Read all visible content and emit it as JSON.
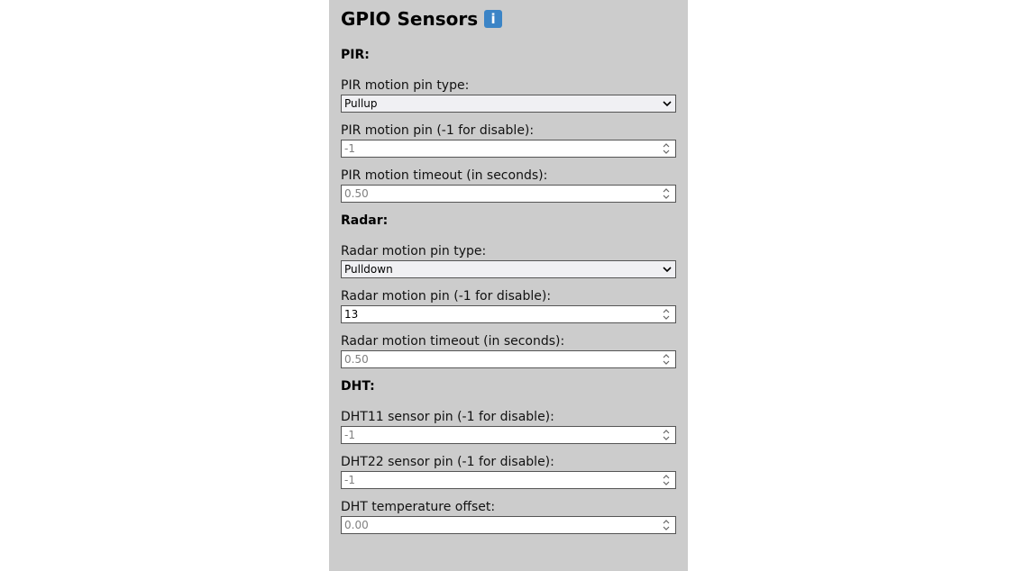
{
  "header": {
    "title": "GPIO Sensors",
    "info_icon": "info-icon",
    "info_glyph": "i"
  },
  "pir": {
    "heading": "PIR:",
    "pin_type_label": "PIR motion pin type:",
    "pin_type_value": "Pullup",
    "pin_label": "PIR motion pin (-1 for disable):",
    "pin_value": "-1",
    "timeout_label": "PIR motion timeout (in seconds):",
    "timeout_value": "0.50"
  },
  "radar": {
    "heading": "Radar:",
    "pin_type_label": "Radar motion pin type:",
    "pin_type_value": "Pulldown",
    "pin_label": "Radar motion pin (-1 for disable):",
    "pin_value": "13",
    "timeout_label": "Radar motion timeout (in seconds):",
    "timeout_value": "0.50"
  },
  "dht": {
    "heading": "DHT:",
    "dht11_label": "DHT11 sensor pin (-1 for disable):",
    "dht11_value": "-1",
    "dht22_label": "DHT22 sensor pin (-1 for disable):",
    "dht22_value": "-1",
    "offset_label": "DHT temperature offset:",
    "offset_value": "0.00"
  },
  "colors": {
    "panel_bg": "#cccccc",
    "info_icon_bg": "#3b84c6"
  }
}
